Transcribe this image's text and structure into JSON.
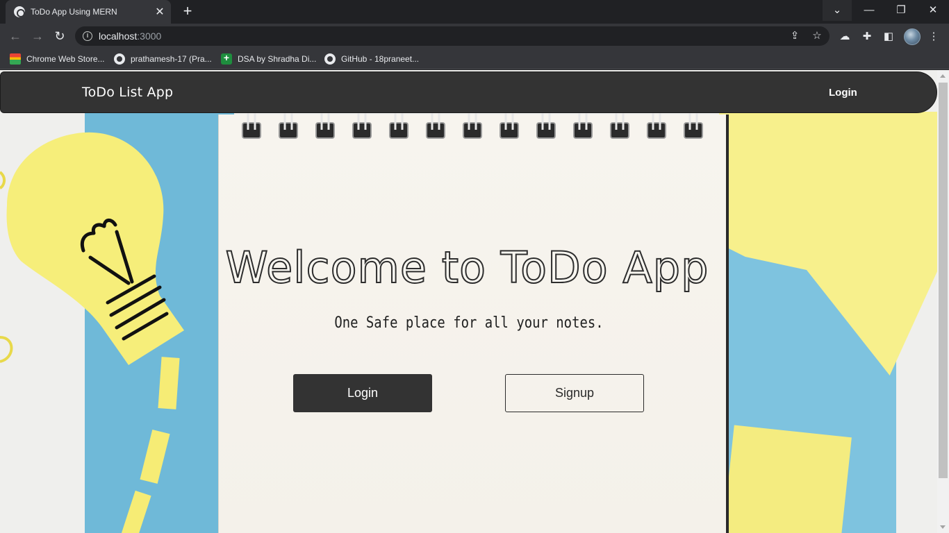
{
  "browser": {
    "tab_title": "ToDo App Using MERN",
    "tab_close": "✕",
    "new_tab": "+",
    "url_host": "localhost",
    "url_port": ":3000",
    "window": {
      "tab_search": "⌄",
      "minimize": "—",
      "restore": "❐",
      "close": "✕"
    },
    "nav": {
      "back": "←",
      "forward": "→",
      "reload": "↻"
    },
    "bookmarks": [
      {
        "label": "Chrome Web Store...",
        "icon": "chrome-web-store-icon"
      },
      {
        "label": "prathamesh-17 (Pra...",
        "icon": "github-icon"
      },
      {
        "label": "DSA by Shradha Di...",
        "icon": "google-sheets-icon"
      },
      {
        "label": "GitHub - 18praneet...",
        "icon": "github-icon"
      }
    ]
  },
  "navbar": {
    "brand": "ToDo List App",
    "login": "Login"
  },
  "hero": {
    "title": "Welcome to ToDo App",
    "subtitle": "One Safe place for all your notes.",
    "login_button": "Login",
    "signup_button": "Signup"
  },
  "colors": {
    "navbar_bg": "#333333",
    "primary_button": "#333333",
    "paper": "#f7f4ee",
    "blue_paper": "#6fb9d8",
    "yellow_paper": "#f7f08c"
  }
}
